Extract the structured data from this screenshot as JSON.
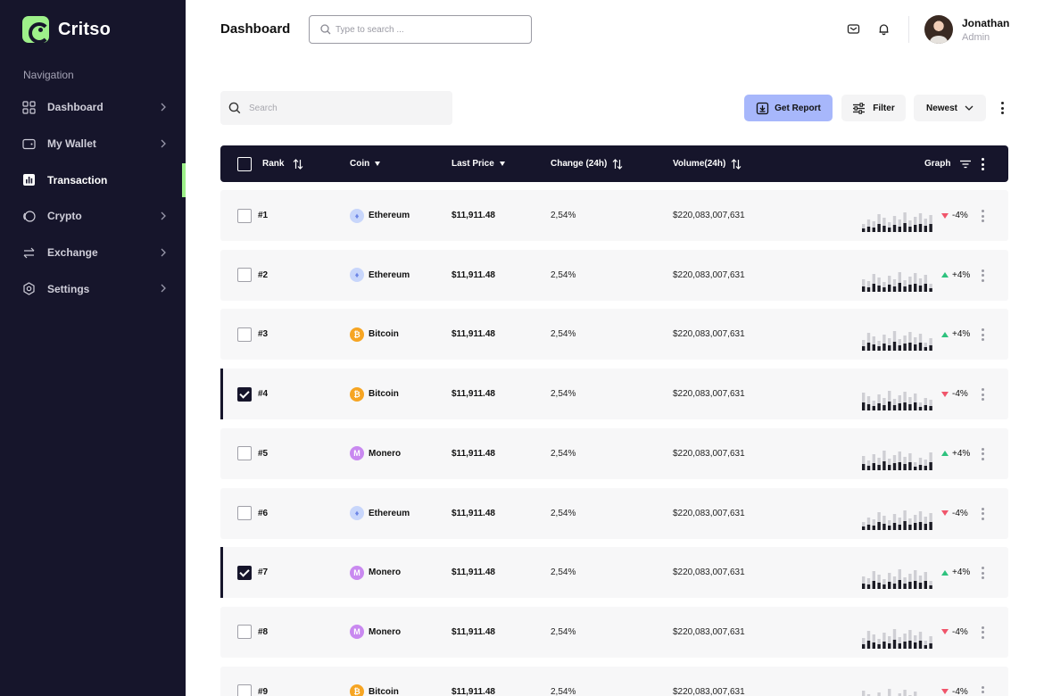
{
  "brand": {
    "name": "Critso",
    "accent": "#9ef08a",
    "sidebar_bg": "#16152b"
  },
  "nav": {
    "heading": "Navigation",
    "items": [
      {
        "label": "Dashboard",
        "icon": "grid-icon",
        "chevron": true,
        "active": false
      },
      {
        "label": "My Wallet",
        "icon": "wallet-icon",
        "chevron": true,
        "active": false
      },
      {
        "label": "Transaction",
        "icon": "bar-chart-icon",
        "chevron": false,
        "active": true
      },
      {
        "label": "Crypto",
        "icon": "coin-icon",
        "chevron": true,
        "active": false
      },
      {
        "label": "Exchange",
        "icon": "exchange-icon",
        "chevron": true,
        "active": false
      },
      {
        "label": "Settings",
        "icon": "settings-icon",
        "chevron": true,
        "active": false
      }
    ]
  },
  "header": {
    "title": "Dashboard",
    "search_placeholder": "Type to search ...",
    "user": {
      "name": "Jonathan",
      "role": "Admin"
    }
  },
  "toolbar": {
    "search_placeholder": "Search",
    "report_label": "Get Report",
    "filter_label": "Filter",
    "sort_label": "Newest",
    "report_color": "#a7b7fb"
  },
  "table": {
    "columns": {
      "rank": "Rank",
      "coin": "Coin",
      "last_price": "Last Price",
      "change": "Change (24h)",
      "volume": "Volume(24h)",
      "graph": "Graph"
    },
    "rows": [
      {
        "rank": "#1",
        "coin": "Ethereum",
        "symbol": "eth",
        "price": "$11,911.48",
        "change": "2,54%",
        "volume": "$220,083,007,631",
        "trend": "-4%",
        "direction": "down",
        "checked": false
      },
      {
        "rank": "#2",
        "coin": "Ethereum",
        "symbol": "eth",
        "price": "$11,911.48",
        "change": "2,54%",
        "volume": "$220,083,007,631",
        "trend": "+4%",
        "direction": "up",
        "checked": false
      },
      {
        "rank": "#3",
        "coin": "Bitcoin",
        "symbol": "btc",
        "price": "$11,911.48",
        "change": "2,54%",
        "volume": "$220,083,007,631",
        "trend": "+4%",
        "direction": "up",
        "checked": false
      },
      {
        "rank": "#4",
        "coin": "Bitcoin",
        "symbol": "btc",
        "price": "$11,911.48",
        "change": "2,54%",
        "volume": "$220,083,007,631",
        "trend": "-4%",
        "direction": "down",
        "checked": true
      },
      {
        "rank": "#5",
        "coin": "Monero",
        "symbol": "xmr",
        "price": "$11,911.48",
        "change": "2,54%",
        "volume": "$220,083,007,631",
        "trend": "+4%",
        "direction": "up",
        "checked": false
      },
      {
        "rank": "#6",
        "coin": "Ethereum",
        "symbol": "eth",
        "price": "$11,911.48",
        "change": "2,54%",
        "volume": "$220,083,007,631",
        "trend": "-4%",
        "direction": "down",
        "checked": false
      },
      {
        "rank": "#7",
        "coin": "Monero",
        "symbol": "xmr",
        "price": "$11,911.48",
        "change": "2,54%",
        "volume": "$220,083,007,631",
        "trend": "+4%",
        "direction": "up",
        "checked": true
      },
      {
        "rank": "#8",
        "coin": "Monero",
        "symbol": "xmr",
        "price": "$11,911.48",
        "change": "2,54%",
        "volume": "$220,083,007,631",
        "trend": "-4%",
        "direction": "down",
        "checked": false
      },
      {
        "rank": "#9",
        "coin": "Bitcoin",
        "symbol": "btc",
        "price": "$11,911.48",
        "change": "2,54%",
        "volume": "$220,083,007,631",
        "trend": "-4%",
        "direction": "down",
        "checked": false
      }
    ]
  },
  "colors": {
    "up": "#2ec27e",
    "down": "#f0556b"
  }
}
